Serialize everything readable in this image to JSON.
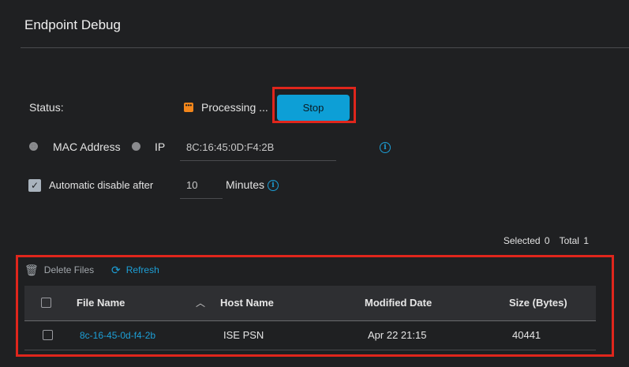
{
  "page": {
    "title": "Endpoint Debug"
  },
  "status": {
    "label": "Status:",
    "icon": "processing-icon",
    "value": "Processing ...",
    "stop_label": "Stop"
  },
  "identifier": {
    "mac_label": "MAC Address",
    "ip_label": "IP",
    "selected": "MAC Address",
    "value": "8C:16:45:0D:F4:2B"
  },
  "auto_disable": {
    "label": "Automatic disable after",
    "checked": true,
    "value": "10",
    "unit": "Minutes"
  },
  "selection": {
    "selected_label": "Selected",
    "selected_count": "0",
    "total_label": "Total",
    "total_count": "1"
  },
  "toolbar": {
    "delete_label": "Delete Files",
    "refresh_label": "Refresh"
  },
  "table": {
    "columns": [
      "File Name",
      "Host Name",
      "Modified Date",
      "Size (Bytes)"
    ],
    "rows": [
      {
        "file_name": "8c-16-45-0d-f4-2b",
        "host_name": "ISE PSN",
        "modified_date": "Apr 22 21:15",
        "size": "40441"
      }
    ]
  },
  "colors": {
    "accent": "#1d9fd6",
    "highlight": "#e0261c",
    "processing": "#f2861b",
    "background": "#1f2022"
  }
}
